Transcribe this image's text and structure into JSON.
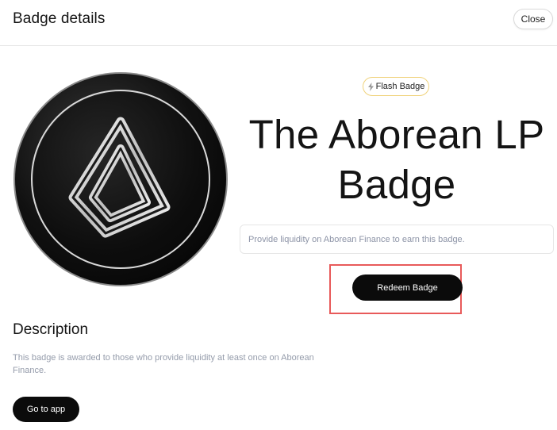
{
  "header": {
    "title": "Badge details",
    "close_label": "Close"
  },
  "badge": {
    "icon": "aborean-logo-coin",
    "chip_icon": "lightning-icon",
    "chip_label": "Flash Badge",
    "title": "The Aborean LP Badge",
    "requirement": "Provide liquidity on Aborean Finance to earn this badge.",
    "redeem_label": "Redeem Badge"
  },
  "description": {
    "heading": "Description",
    "text": "This badge is awarded to those who provide liquidity at least once on Aborean Finance.",
    "cta_label": "Go to app"
  },
  "colors": {
    "primary_button": "#0b0b0b",
    "chip_border": "#f0d27a",
    "highlight_border": "#e85a5a",
    "muted_text": "#959cab"
  }
}
